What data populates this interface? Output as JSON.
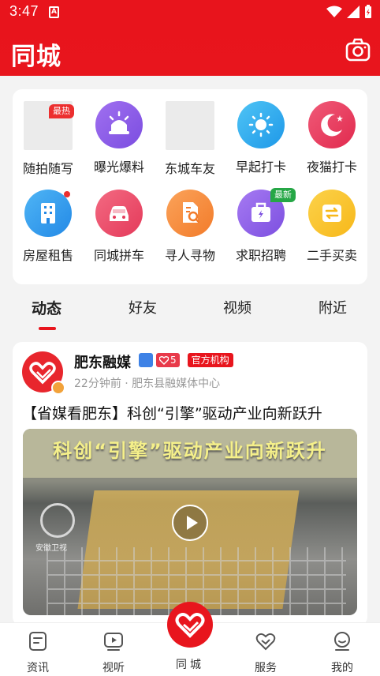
{
  "status_bar": {
    "time": "3:47",
    "sim_label": "A"
  },
  "header": {
    "title": "同城"
  },
  "grid": {
    "items": [
      {
        "label": "随拍随写",
        "icon": "placeholder-image",
        "badge": "最热"
      },
      {
        "label": "曝光爆料",
        "icon": "siren-icon"
      },
      {
        "label": "东城车友",
        "icon": "placeholder-image"
      },
      {
        "label": "早起打卡",
        "icon": "sun-icon"
      },
      {
        "label": "夜猫打卡",
        "icon": "moon-icon"
      },
      {
        "label": "房屋租售",
        "icon": "building-icon",
        "dot": true
      },
      {
        "label": "同城拼车",
        "icon": "car-icon"
      },
      {
        "label": "寻人寻物",
        "icon": "document-search-icon"
      },
      {
        "label": "求职招聘",
        "icon": "briefcase-icon",
        "badge": "最新"
      },
      {
        "label": "二手买卖",
        "icon": "swap-icon"
      }
    ]
  },
  "tabs": [
    {
      "label": "动态",
      "active": true
    },
    {
      "label": "好友"
    },
    {
      "label": "视频"
    },
    {
      "label": "附近"
    }
  ],
  "feed": {
    "author": "肥东融媒",
    "heart_count": "5",
    "official_tag": "官方机构",
    "subline": "22分钟前 · 肥东县融媒体中心",
    "headline": "【省媒看肥东】科创“引擎”驱动产业向新跃升",
    "video_banner": "科创“引擎”驱动产业向新跃升",
    "video_logo_text": "安徽卫视"
  },
  "bottom_nav": [
    {
      "label": "资讯",
      "icon": "news-icon"
    },
    {
      "label": "视听",
      "icon": "video-play-icon"
    },
    {
      "label": "同城",
      "icon": "heart-logo-icon"
    },
    {
      "label": "服务",
      "icon": "heart-service-icon"
    },
    {
      "label": "我的",
      "icon": "profile-icon"
    }
  ],
  "colors": {
    "brand_red": "#e8151d",
    "badge_green": "#26a746"
  }
}
